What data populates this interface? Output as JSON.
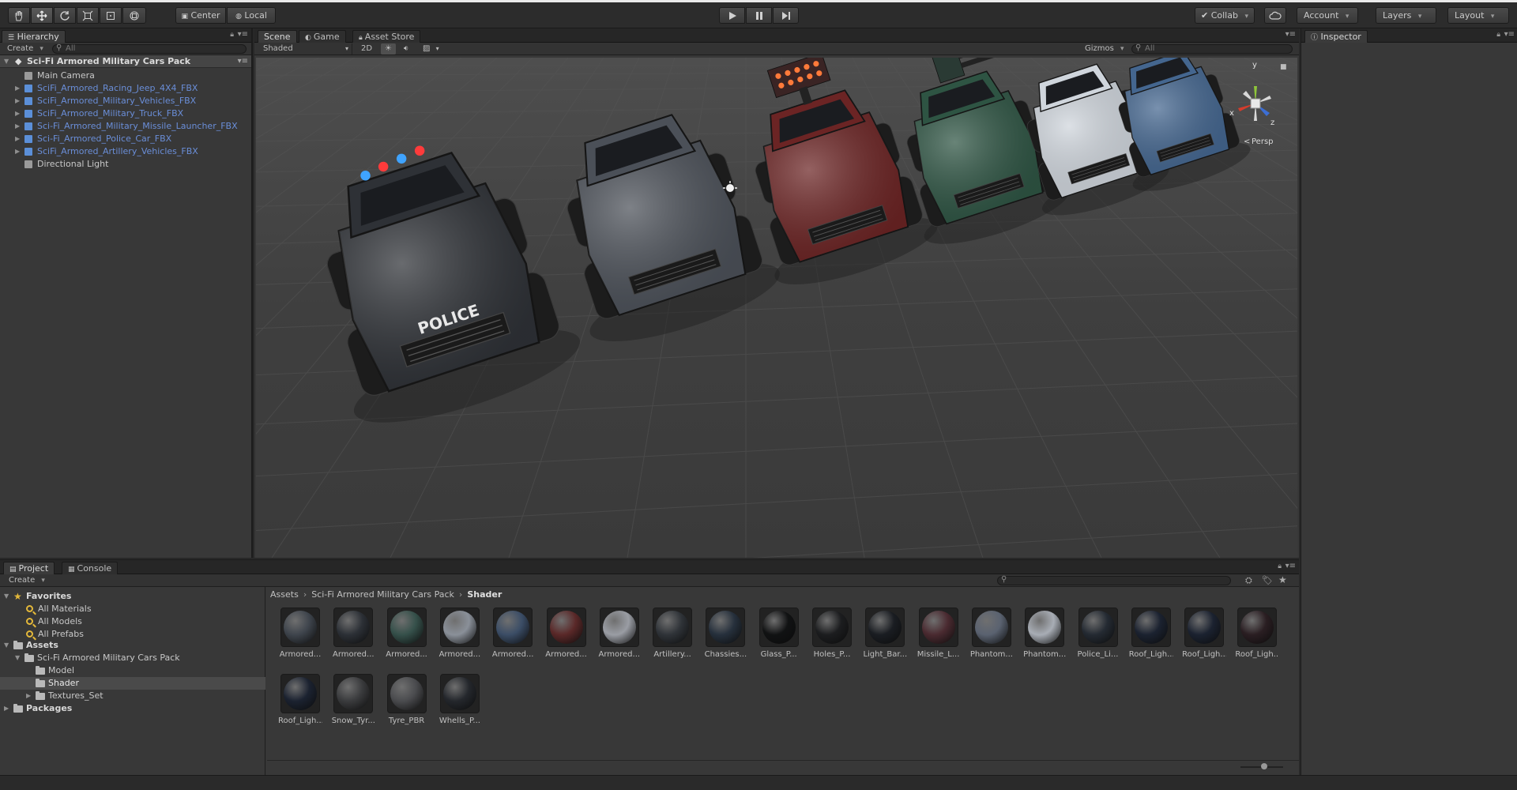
{
  "toolbar": {
    "center_label": "Center",
    "local_label": "Local",
    "collab_label": "Collab",
    "account_label": "Account",
    "layers_label": "Layers",
    "layout_label": "Layout",
    "tool_icons": [
      "hand-icon",
      "move-icon",
      "rotate-icon",
      "scale-icon",
      "rect-tool-icon",
      "transform-icon"
    ]
  },
  "hierarchy": {
    "tab_label": "Hierarchy",
    "create_label": "Create",
    "search_placeholder": "All",
    "scene_name": "Sci-Fi Armored Military Cars Pack",
    "items": [
      {
        "label": "Main Camera",
        "prefab": false,
        "expandable": false
      },
      {
        "label": "SciFi_Armored_Racing_Jeep_4X4_FBX",
        "prefab": true,
        "expandable": true
      },
      {
        "label": "SciFi_Armored_Military_Vehicles_FBX",
        "prefab": true,
        "expandable": true
      },
      {
        "label": "SciFi_Armored_Military_Truck_FBX",
        "prefab": true,
        "expandable": true
      },
      {
        "label": "Sci-Fi_Armored_Military_Missile_Launcher_FBX",
        "prefab": true,
        "expandable": true
      },
      {
        "label": "Sci-Fi_Armored_Police_Car_FBX",
        "prefab": true,
        "expandable": true
      },
      {
        "label": "SciFi_Armored_Artillery_Vehicles_FBX",
        "prefab": true,
        "expandable": true
      },
      {
        "label": "Directional Light",
        "prefab": false,
        "expandable": false
      }
    ]
  },
  "scene_view": {
    "tabs": [
      {
        "label": "Scene",
        "active": true
      },
      {
        "label": "Game",
        "active": false
      },
      {
        "label": "Asset Store",
        "active": false
      }
    ],
    "shading_mode": "Shaded",
    "mode_2d_label": "2D",
    "gizmos_label": "Gizmos",
    "search_placeholder": "All",
    "projection_label": "Persp",
    "gizmo_axes": {
      "x": "x",
      "y": "y",
      "z": "z"
    },
    "police_text": "POLICE",
    "vehicle_colors": [
      "#2e3136",
      "#4b5058",
      "#6b2424",
      "#2e5443",
      "#cfd5dc",
      "#44668f"
    ]
  },
  "inspector": {
    "tab_label": "Inspector"
  },
  "project": {
    "tabs": [
      {
        "label": "Project",
        "active": true
      },
      {
        "label": "Console",
        "active": false
      }
    ],
    "create_label": "Create",
    "favorites_label": "Favorites",
    "favorites": [
      "All Materials",
      "All Models",
      "All Prefabs"
    ],
    "assets_label": "Assets",
    "tree": [
      {
        "label": "Sci-Fi Armored Military Cars Pack",
        "depth": 1,
        "expandable": true
      },
      {
        "label": "Model",
        "depth": 2,
        "expandable": false
      },
      {
        "label": "Shader",
        "depth": 2,
        "expandable": false,
        "selected": true
      },
      {
        "label": "Textures_Set",
        "depth": 2,
        "expandable": true
      }
    ],
    "packages_label": "Packages",
    "breadcrumb": [
      "Assets",
      "Sci-Fi Armored Military Cars Pack",
      "Shader"
    ],
    "materials": [
      {
        "label": "Armored...",
        "color": "#3e444c"
      },
      {
        "label": "Armored...",
        "color": "#2c3036"
      },
      {
        "label": "Armored...",
        "color": "#35504a"
      },
      {
        "label": "Armored...",
        "color": "#8a9099"
      },
      {
        "label": "Armored...",
        "color": "#3b4d66"
      },
      {
        "label": "Armored...",
        "color": "#5a2828"
      },
      {
        "label": "Armored...",
        "color": "#9a9da4"
      },
      {
        "label": "Artillery...",
        "color": "#2f3338"
      },
      {
        "label": "Chassies...",
        "color": "#26303c"
      },
      {
        "label": "Glass_P...",
        "color": "#111213"
      },
      {
        "label": "Holes_P...",
        "color": "#1c1d1f"
      },
      {
        "label": "Light_Bar...",
        "color": "#1a1d22"
      },
      {
        "label": "Missile_L...",
        "color": "#4a2a30"
      },
      {
        "label": "Phantom...",
        "color": "#5a6270"
      },
      {
        "label": "Phantom...",
        "color": "#a8adb5"
      },
      {
        "label": "Police_Li...",
        "color": "#242a32"
      },
      {
        "label": "Roof_Ligh...",
        "color": "#1b2230"
      },
      {
        "label": "Roof_Ligh...",
        "color": "#1b2230"
      },
      {
        "label": "Roof_Ligh...",
        "color": "#2a1e22"
      },
      {
        "label": "Roof_Ligh...",
        "color": "#1b2230"
      },
      {
        "label": "Snow_Tyr...",
        "color": "#3a3b3d"
      },
      {
        "label": "Tyre_PBR",
        "color": "#4a4b4e"
      },
      {
        "label": "Whells_P...",
        "color": "#24272c"
      }
    ]
  }
}
